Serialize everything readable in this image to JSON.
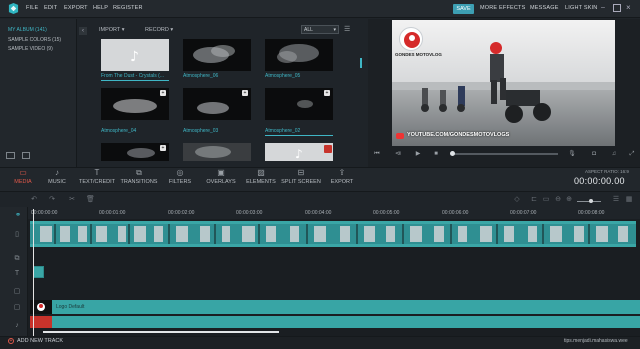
{
  "menubar": {
    "items": [
      "FILE",
      "EDIT",
      "EXPORT",
      "HELP",
      "REGISTER"
    ],
    "right": [
      "SAVE",
      "MORE EFFECTS",
      "MESSAGE",
      "LIGHT SKIN"
    ]
  },
  "sidebar": {
    "items": [
      "MY ALBUM (141)",
      "SAMPLE COLORS (15)",
      "SAMPLE VIDEO (9)"
    ]
  },
  "library": {
    "import": "IMPORT",
    "record": "RECORD",
    "filter": "ALL",
    "thumbs": [
      {
        "caption": "From The Dust - Crystals (...",
        "kind": "audio"
      },
      {
        "caption": "Atmosphere_06",
        "kind": "smoke"
      },
      {
        "caption": "Atmosphere_05",
        "kind": "smoke"
      },
      {
        "caption": "Atmosphere_04",
        "kind": "smoke"
      },
      {
        "caption": "Atmosphere_03",
        "kind": "smoke"
      },
      {
        "caption": "Atmosphere_02",
        "kind": "smoke"
      },
      {
        "caption": "",
        "kind": "smoke"
      },
      {
        "caption": "",
        "kind": "smoke"
      },
      {
        "caption": "",
        "kind": "audio"
      }
    ]
  },
  "preview": {
    "channel_name": "GONDES MOTOVLOG",
    "url": "YOUTUBE.COM/GONDESMOTOVLOGS"
  },
  "toolbar": {
    "tabs": [
      "MEDIA",
      "MUSIC",
      "TEXT/CREDIT",
      "TRANSITIONS",
      "FILTERS",
      "OVERLAYS",
      "ELEMENTS",
      "SPLIT SCREEN",
      "EXPORT"
    ],
    "icons": [
      "folder-icon",
      "music-icon",
      "text-icon",
      "transitions-icon",
      "filters-icon",
      "overlays-icon",
      "elements-icon",
      "split-screen-icon",
      "export-icon"
    ],
    "aspect": "ASPECT RATIO: 16:9",
    "timecode": "00:00:00.00"
  },
  "ruler": {
    "ticks": [
      "00:00:00:00",
      "00:00:01:00",
      "00:00:02:00",
      "00:00:03:00",
      "00:00:04:00",
      "00:00:05:00",
      "00:00:06:00",
      "00:00:07:00",
      "00:00:08:00"
    ]
  },
  "timeline": {
    "title_clip": "Logo Default"
  },
  "footer": {
    "add_track": "ADD NEW TRACK",
    "watermark": "tips.menjadi.mahasiswa.wee"
  },
  "colors": {
    "accent": "#3fb6c5",
    "active_tab": "#e0584a",
    "clip": "#3aa6a6"
  }
}
